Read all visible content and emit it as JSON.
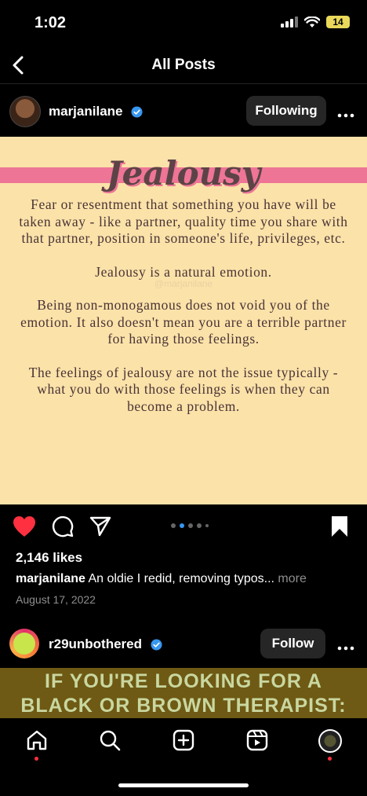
{
  "status_bar": {
    "time": "1:02",
    "battery": "14"
  },
  "nav": {
    "title": "All Posts"
  },
  "post1": {
    "username": "marjanilane",
    "follow_label": "Following",
    "image": {
      "title": "Jealousy",
      "watermark": "@marjanilane",
      "paragraphs": [
        "Fear or resentment that something you have will be taken away - like a partner, quality time you share with that partner, position in someone's life, privileges, etc.",
        "Jealousy is a natural emotion.",
        "Being non-monogamous does not void you of the emotion. It also doesn't mean you are a terrible partner for having those feelings.",
        "The feelings of jealousy are not the issue typically - what you do with those feelings is when they can become a problem."
      ]
    },
    "likes": "2,146 likes",
    "caption_user": "marjanilane",
    "caption_text": " An oldie I redid, removing typos...",
    "caption_more": " more",
    "date": "August 17, 2022"
  },
  "post2": {
    "username": "r29unbothered",
    "follow_label": "Follow",
    "image_text_line1": "IF YOU'RE LOOKING FOR A",
    "image_text_line2": "BLACK OR BROWN THERAPIST:"
  },
  "colors": {
    "like_red": "#ff3040",
    "verified_blue": "#3897f0",
    "post_bg": "#fbe2a9",
    "band_pink": "#ee7596"
  },
  "icons": [
    "back-chevron-icon",
    "verified-badge-icon",
    "more-icon",
    "heart-icon",
    "comment-icon",
    "share-icon",
    "bookmark-icon",
    "home-icon",
    "search-icon",
    "create-icon",
    "reels-icon",
    "profile-icon"
  ]
}
